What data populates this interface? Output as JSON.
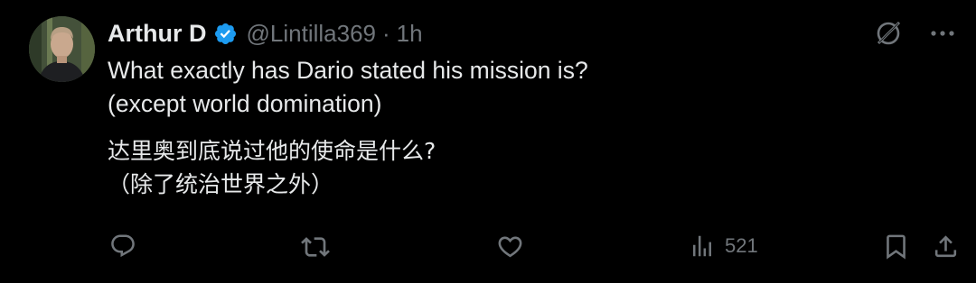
{
  "author": {
    "name": "Arthur D",
    "handle": "@Lintilla369",
    "separator": "·",
    "time": "1h",
    "verified_color": "#1d9bf0"
  },
  "tweet": {
    "lines_en": [
      "What exactly has Dario stated his mission is?",
      "(except world domination)"
    ],
    "lines_zh": [
      "达里奥到底说过他的使命是什么?",
      "（除了统治世界之外）"
    ]
  },
  "actions": {
    "reply_icon": "reply-icon",
    "retweet_icon": "retweet-icon",
    "like_icon": "heart-icon",
    "views_icon": "views-chart-icon",
    "views_count": "521",
    "bookmark_icon": "bookmark-icon",
    "share_icon": "share-icon"
  },
  "header_icons": {
    "grok": "grok-icon",
    "more": "more-icon"
  },
  "colors": {
    "background": "#000000",
    "text": "#e7e9ea",
    "muted": "#71767b",
    "accent": "#1d9bf0"
  }
}
